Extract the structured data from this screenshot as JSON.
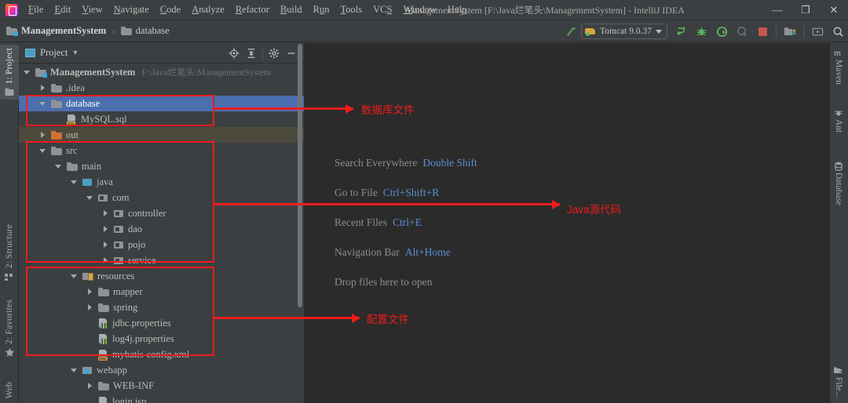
{
  "window": {
    "title": "ManagementSystem [F:\\Java烂笔头\\ManagementSystem] - IntelliJ IDEA",
    "minimize": "—",
    "maximize": "❐",
    "close": "✕",
    "logo_name": "intellij-idea-logo"
  },
  "menubar": {
    "items": [
      {
        "label": "File",
        "mnemonic": "F"
      },
      {
        "label": "Edit",
        "mnemonic": "E"
      },
      {
        "label": "View",
        "mnemonic": "V"
      },
      {
        "label": "Navigate",
        "mnemonic": "N"
      },
      {
        "label": "Code",
        "mnemonic": "C"
      },
      {
        "label": "Analyze",
        "mnemonic": "A"
      },
      {
        "label": "Refactor",
        "mnemonic": "R"
      },
      {
        "label": "Build",
        "mnemonic": "B"
      },
      {
        "label": "Run",
        "mnemonic": "u"
      },
      {
        "label": "Tools",
        "mnemonic": "T"
      },
      {
        "label": "VCS",
        "mnemonic": "S"
      },
      {
        "label": "Window",
        "mnemonic": "W"
      },
      {
        "label": "Help",
        "mnemonic": "H"
      }
    ]
  },
  "breadcrumb": {
    "project": "ManagementSystem",
    "separator": "›",
    "current": "database"
  },
  "toolbar": {
    "build_label": "build-hammer-icon",
    "run_config": "Tomcat 9.0.37",
    "run_label": "run-icon",
    "debug_label": "debug-icon",
    "run_coverage_label": "run-with-coverage-icon",
    "profile_label": "profiler-icon",
    "stop_label": "stop-icon",
    "project_structure_label": "project-structure-icon",
    "updates_label": "updates-icon",
    "search_label": "search-everywhere-icon"
  },
  "left_tool_window_bar": {
    "items": [
      {
        "label": "1: Project",
        "icon": "project-icon",
        "active": true
      },
      {
        "label": "2: Structure",
        "icon": "structure-icon",
        "active": false
      },
      {
        "label": "2: Favorites",
        "icon": "star-icon",
        "active": false
      },
      {
        "label": "Web",
        "icon": "web-icon",
        "active": false
      }
    ]
  },
  "right_tool_window_bar": {
    "items": [
      {
        "label": "Maven",
        "icon": "maven-icon"
      },
      {
        "label": "Ant",
        "icon": "ant-icon"
      },
      {
        "label": "Database",
        "icon": "database-icon"
      }
    ],
    "bottom_items": [
      {
        "label": "File...",
        "icon": "file-transfer-icon"
      }
    ]
  },
  "project_panel": {
    "title": "Project",
    "dropdown_caret": "▾",
    "tools": [
      {
        "name": "scroll-from-source-icon",
        "glyph": "⊕"
      },
      {
        "name": "collapse-all-icon",
        "glyph": "⇥"
      },
      {
        "name": "settings-gear-icon",
        "glyph": "✱"
      },
      {
        "name": "hide-panel-icon",
        "glyph": "—"
      }
    ],
    "tree": [
      {
        "indent": 0,
        "twisty": "open",
        "icon": "module",
        "label": "ManagementSystem",
        "path": "F:\\Java烂笔头\\ManagementSystem",
        "bold": true,
        "state": "normal"
      },
      {
        "indent": 1,
        "twisty": "closed",
        "icon": "folder",
        "label": ".idea",
        "path": "",
        "bold": false,
        "state": "normal"
      },
      {
        "indent": 1,
        "twisty": "open",
        "icon": "folder",
        "label": "database",
        "path": "",
        "bold": false,
        "state": "selected"
      },
      {
        "indent": 2,
        "twisty": "none",
        "icon": "sql",
        "label": "MySQL.sql",
        "path": "",
        "bold": false,
        "state": "normal"
      },
      {
        "indent": 1,
        "twisty": "closed",
        "icon": "folder-orange",
        "label": "out",
        "path": "",
        "bold": false,
        "state": "highlight"
      },
      {
        "indent": 1,
        "twisty": "open",
        "icon": "folder",
        "label": "src",
        "path": "",
        "bold": false,
        "state": "normal"
      },
      {
        "indent": 2,
        "twisty": "open",
        "icon": "folder",
        "label": "main",
        "path": "",
        "bold": false,
        "state": "normal"
      },
      {
        "indent": 3,
        "twisty": "open",
        "icon": "javasrc",
        "label": "java",
        "path": "",
        "bold": false,
        "state": "normal"
      },
      {
        "indent": 4,
        "twisty": "open",
        "icon": "package",
        "label": "com",
        "path": "",
        "bold": false,
        "state": "normal"
      },
      {
        "indent": 5,
        "twisty": "closed",
        "icon": "package",
        "label": "controller",
        "path": "",
        "bold": false,
        "state": "normal"
      },
      {
        "indent": 5,
        "twisty": "closed",
        "icon": "package",
        "label": "dao",
        "path": "",
        "bold": false,
        "state": "normal"
      },
      {
        "indent": 5,
        "twisty": "closed",
        "icon": "package",
        "label": "pojo",
        "path": "",
        "bold": false,
        "state": "normal"
      },
      {
        "indent": 5,
        "twisty": "closed",
        "icon": "package",
        "label": "service",
        "path": "",
        "bold": false,
        "state": "normal"
      },
      {
        "indent": 3,
        "twisty": "open",
        "icon": "resources",
        "label": "resources",
        "path": "",
        "bold": false,
        "state": "normal"
      },
      {
        "indent": 4,
        "twisty": "closed",
        "icon": "folder",
        "label": "mapper",
        "path": "",
        "bold": false,
        "state": "normal"
      },
      {
        "indent": 4,
        "twisty": "closed",
        "icon": "folder",
        "label": "spring",
        "path": "",
        "bold": false,
        "state": "normal"
      },
      {
        "indent": 4,
        "twisty": "none",
        "icon": "props",
        "label": "jdbc.properties",
        "path": "",
        "bold": false,
        "state": "normal"
      },
      {
        "indent": 4,
        "twisty": "none",
        "icon": "props",
        "label": "log4j.properties",
        "path": "",
        "bold": false,
        "state": "normal"
      },
      {
        "indent": 4,
        "twisty": "none",
        "icon": "xml",
        "label": "mybatis-config.xml",
        "path": "",
        "bold": false,
        "state": "normal"
      },
      {
        "indent": 3,
        "twisty": "open",
        "icon": "webapp",
        "label": "webapp",
        "path": "",
        "bold": false,
        "state": "normal"
      },
      {
        "indent": 4,
        "twisty": "closed",
        "icon": "folder",
        "label": "WEB-INF",
        "path": "",
        "bold": false,
        "state": "normal"
      },
      {
        "indent": 4,
        "twisty": "none",
        "icon": "jsp",
        "label": "login.jsp",
        "path": "",
        "bold": false,
        "state": "normal"
      }
    ]
  },
  "editor": {
    "tips": [
      {
        "label": "Search Everywhere",
        "key": "Double Shift"
      },
      {
        "label": "Go to File",
        "key": "Ctrl+Shift+R"
      },
      {
        "label": "Recent Files",
        "key": "Ctrl+E"
      },
      {
        "label": "Navigation Bar",
        "key": "Alt+Home"
      },
      {
        "label": "Drop files here to open",
        "key": ""
      }
    ]
  },
  "annotations": {
    "accent_color": "#ee1c1c",
    "labels": [
      {
        "id": "database-files",
        "text": "数据库文件"
      },
      {
        "id": "java-source-code",
        "text": "Java源代码"
      },
      {
        "id": "config-files",
        "text": "配置文件"
      }
    ]
  }
}
